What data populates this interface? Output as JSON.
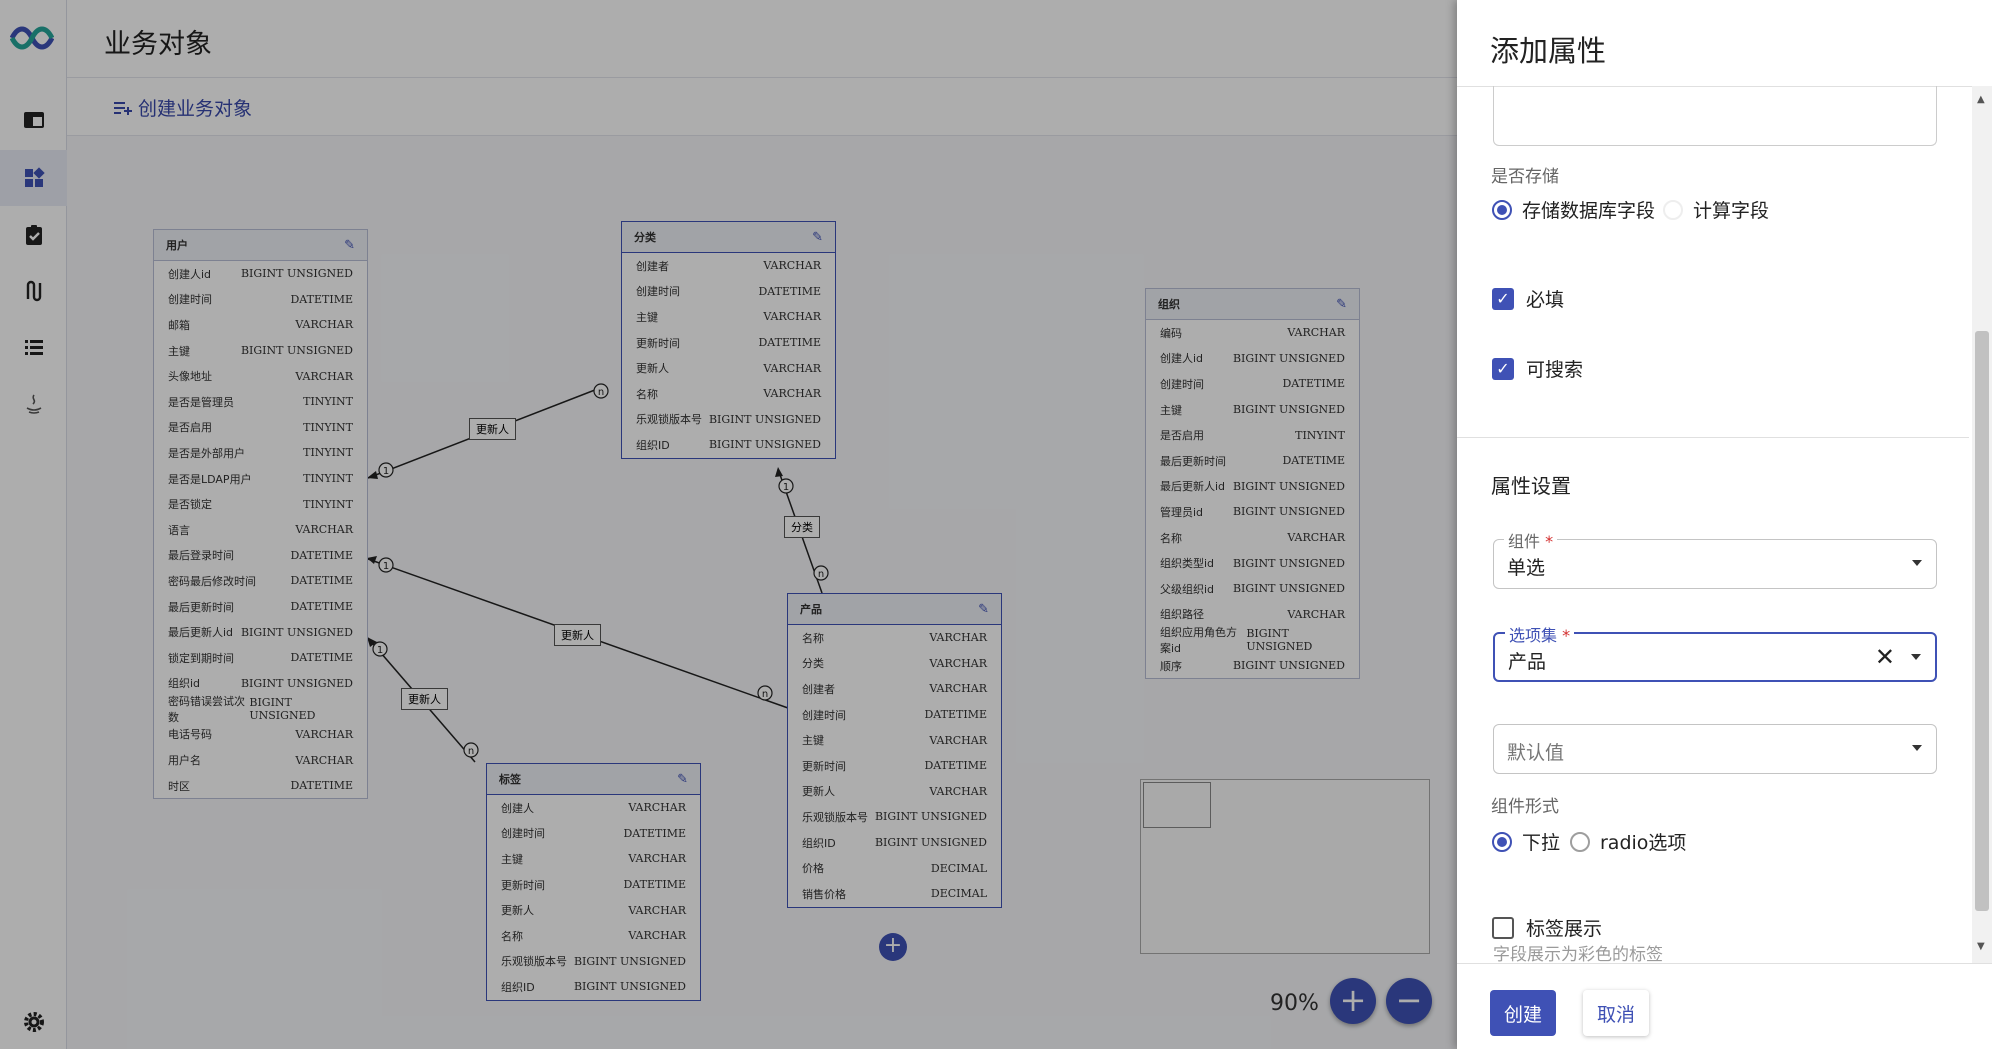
{
  "app": {
    "title": "业务对象",
    "create_label": "创建业务对象"
  },
  "nav": [
    "table-icon",
    "dashboard-icon",
    "clipboard-check-icon",
    "flow-icon",
    "list-icon",
    "java-icon",
    "gear-icon"
  ],
  "entities": {
    "user": {
      "title": "用户",
      "rows": [
        [
          "创建人id",
          "BIGINT UNSIGNED"
        ],
        [
          "创建时间",
          "DATETIME"
        ],
        [
          "邮箱",
          "VARCHAR"
        ],
        [
          "主键",
          "BIGINT UNSIGNED"
        ],
        [
          "头像地址",
          "VARCHAR"
        ],
        [
          "是否是管理员",
          "TINYINT"
        ],
        [
          "是否启用",
          "TINYINT"
        ],
        [
          "是否是外部用户",
          "TINYINT"
        ],
        [
          "是否是LDAP用户",
          "TINYINT"
        ],
        [
          "是否锁定",
          "TINYINT"
        ],
        [
          "语言",
          "VARCHAR"
        ],
        [
          "最后登录时间",
          "DATETIME"
        ],
        [
          "密码最后修改时间",
          "DATETIME"
        ],
        [
          "最后更新时间",
          "DATETIME"
        ],
        [
          "最后更新人id",
          "BIGINT UNSIGNED"
        ],
        [
          "锁定到期时间",
          "DATETIME"
        ],
        [
          "组织id",
          "BIGINT UNSIGNED"
        ],
        [
          "密码错误尝试次数",
          "BIGINT UNSIGNED"
        ],
        [
          "电话号码",
          "VARCHAR"
        ],
        [
          "用户名",
          "VARCHAR"
        ],
        [
          "时区",
          "DATETIME"
        ]
      ]
    },
    "category": {
      "title": "分类",
      "rows": [
        [
          "创建者",
          "VARCHAR"
        ],
        [
          "创建时间",
          "DATETIME"
        ],
        [
          "主键",
          "VARCHAR"
        ],
        [
          "更新时间",
          "DATETIME"
        ],
        [
          "更新人",
          "VARCHAR"
        ],
        [
          "名称",
          "VARCHAR"
        ],
        [
          "乐观锁版本号",
          "BIGINT UNSIGNED"
        ],
        [
          "组织ID",
          "BIGINT UNSIGNED"
        ]
      ]
    },
    "org": {
      "title": "组织",
      "rows": [
        [
          "编码",
          "VARCHAR"
        ],
        [
          "创建人id",
          "BIGINT UNSIGNED"
        ],
        [
          "创建时间",
          "DATETIME"
        ],
        [
          "主键",
          "BIGINT UNSIGNED"
        ],
        [
          "是否启用",
          "TINYINT"
        ],
        [
          "最后更新时间",
          "DATETIME"
        ],
        [
          "最后更新人id",
          "BIGINT UNSIGNED"
        ],
        [
          "管理员id",
          "BIGINT UNSIGNED"
        ],
        [
          "名称",
          "VARCHAR"
        ],
        [
          "组织类型id",
          "BIGINT UNSIGNED"
        ],
        [
          "父级组织id",
          "BIGINT UNSIGNED"
        ],
        [
          "组织路径",
          "VARCHAR"
        ],
        [
          "组织应用角色方案id",
          "BIGINT UNSIGNED"
        ],
        [
          "顺序",
          "BIGINT UNSIGNED"
        ]
      ]
    },
    "product": {
      "title": "产品",
      "rows": [
        [
          "名称",
          "VARCHAR"
        ],
        [
          "分类",
          "VARCHAR"
        ],
        [
          "创建者",
          "VARCHAR"
        ],
        [
          "创建时间",
          "DATETIME"
        ],
        [
          "主键",
          "VARCHAR"
        ],
        [
          "更新时间",
          "DATETIME"
        ],
        [
          "更新人",
          "VARCHAR"
        ],
        [
          "乐观锁版本号",
          "BIGINT UNSIGNED"
        ],
        [
          "组织ID",
          "BIGINT UNSIGNED"
        ],
        [
          "价格",
          "DECIMAL"
        ],
        [
          "销售价格",
          "DECIMAL"
        ]
      ]
    },
    "tag": {
      "title": "标签",
      "rows": [
        [
          "创建人",
          "VARCHAR"
        ],
        [
          "创建时间",
          "DATETIME"
        ],
        [
          "主键",
          "VARCHAR"
        ],
        [
          "更新时间",
          "DATETIME"
        ],
        [
          "更新人",
          "VARCHAR"
        ],
        [
          "名称",
          "VARCHAR"
        ],
        [
          "乐观锁版本号",
          "BIGINT UNSIGNED"
        ],
        [
          "组织ID",
          "BIGINT UNSIGNED"
        ]
      ]
    }
  },
  "relations": {
    "r1": "更新人",
    "r2": "分类",
    "r3": "更新人",
    "r4": "更新人",
    "one": "1",
    "many": "n"
  },
  "canvas": {
    "zoom": "90%",
    "zoom_in": "+",
    "zoom_out": "−",
    "add_node": "+"
  },
  "drawer": {
    "title": "添加属性",
    "storage_label": "是否存储",
    "storage_options": [
      "存储数据库字段",
      "计算字段"
    ],
    "required_label": "必填",
    "searchable_label": "可搜索",
    "section_title": "属性设置",
    "component": {
      "label": "组件",
      "value": "单选"
    },
    "option_set": {
      "label": "选项集",
      "value": "产品"
    },
    "default_value": {
      "placeholder": "默认值"
    },
    "form_label": "组件形式",
    "form_options": [
      "下拉",
      "radio选项"
    ],
    "tag_display_label": "标签展示",
    "tag_display_hint": "字段展示为彩色的标签",
    "create_button": "创建",
    "cancel_button": "取消"
  }
}
